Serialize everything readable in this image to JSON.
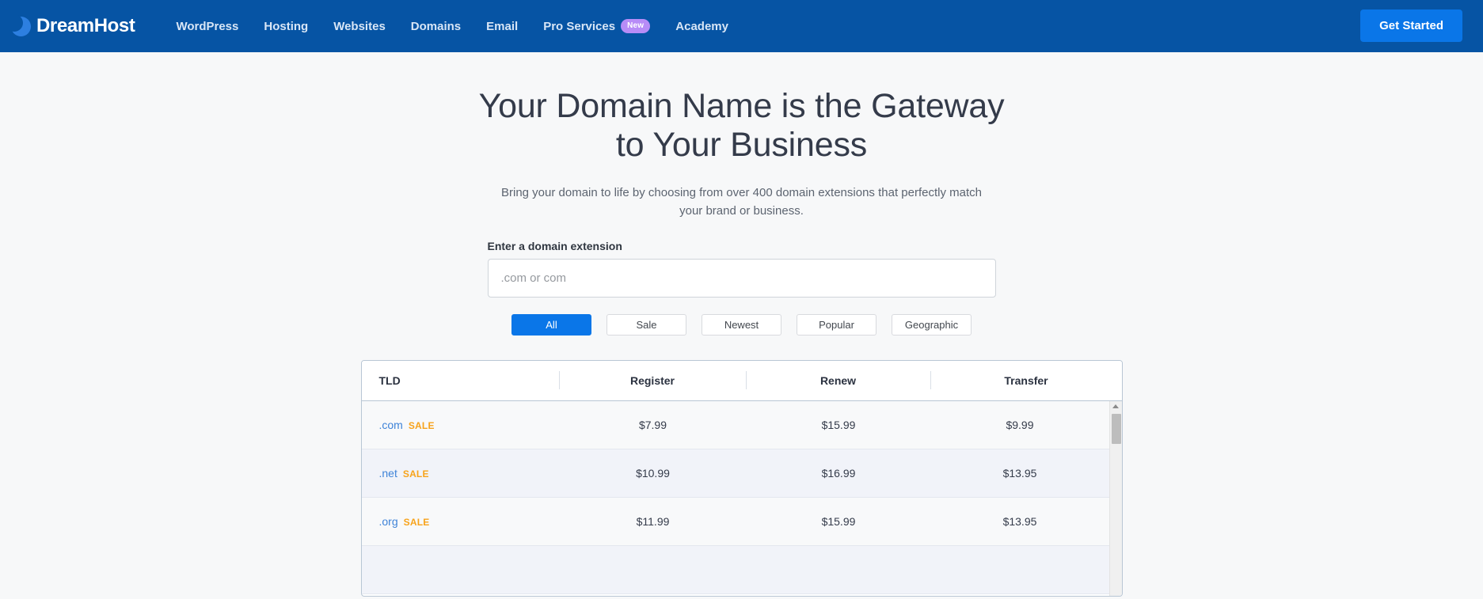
{
  "header": {
    "logo_text": "DreamHost",
    "nav": [
      {
        "label": "WordPress",
        "badge": null
      },
      {
        "label": "Hosting",
        "badge": null
      },
      {
        "label": "Websites",
        "badge": null
      },
      {
        "label": "Domains",
        "badge": null
      },
      {
        "label": "Email",
        "badge": null
      },
      {
        "label": "Pro Services",
        "badge": "New"
      },
      {
        "label": "Academy",
        "badge": null
      }
    ],
    "cta_label": "Get Started",
    "colors": {
      "header_bg": "#0654a4",
      "cta_bg": "#0a76e8",
      "nav_text": "#d8e6f6",
      "badge_bg": "#b78cf7"
    }
  },
  "hero": {
    "title": "Your Domain Name is the Gateway to Your Business",
    "subtitle": "Bring your domain to life by choosing from over 400 domain extensions that perfectly match your brand or business."
  },
  "search": {
    "label": "Enter a domain extension",
    "placeholder": ".com or com",
    "value": ""
  },
  "filters": {
    "active": "All",
    "items": [
      {
        "label": "All",
        "active": true
      },
      {
        "label": "Sale",
        "active": false
      },
      {
        "label": "Newest",
        "active": false
      },
      {
        "label": "Popular",
        "active": false
      },
      {
        "label": "Geographic",
        "active": false
      }
    ],
    "active_color": "#0a76e8"
  },
  "table": {
    "columns": [
      "TLD",
      "Register",
      "Renew",
      "Transfer"
    ],
    "rows": [
      {
        "tld": ".com",
        "tag": "SALE",
        "register": "$7.99",
        "renew": "$15.99",
        "transfer": "$9.99"
      },
      {
        "tld": ".net",
        "tag": "SALE",
        "register": "$10.99",
        "renew": "$16.99",
        "transfer": "$13.95"
      },
      {
        "tld": ".org",
        "tag": "SALE",
        "register": "$11.99",
        "renew": "$15.99",
        "transfer": "$13.95"
      },
      {
        "tld": "",
        "tag": "",
        "register": "",
        "renew": "",
        "transfer": ""
      }
    ],
    "tag_color": "#f7a31b",
    "link_color": "#3e83d8",
    "scrollbar": {
      "position": "right",
      "thumb_at_top": true
    }
  }
}
